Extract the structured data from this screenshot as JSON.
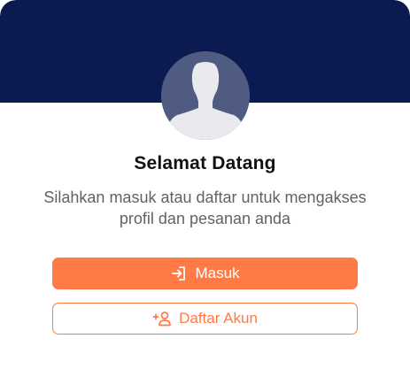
{
  "welcome": {
    "title": "Selamat Datang",
    "subtitle": "Silahkan masuk atau daftar untuk mengakses profil dan pesanan anda"
  },
  "actions": {
    "login_label": "Masuk",
    "login_icon": "login-icon",
    "register_label": "Daftar Akun",
    "register_icon": "add-user-icon"
  },
  "colors": {
    "header": "#0c1a52",
    "accent": "#ff7a45",
    "avatar_bg": "#4f5b80"
  },
  "avatar": {
    "icon": "user-avatar-placeholder-icon"
  }
}
